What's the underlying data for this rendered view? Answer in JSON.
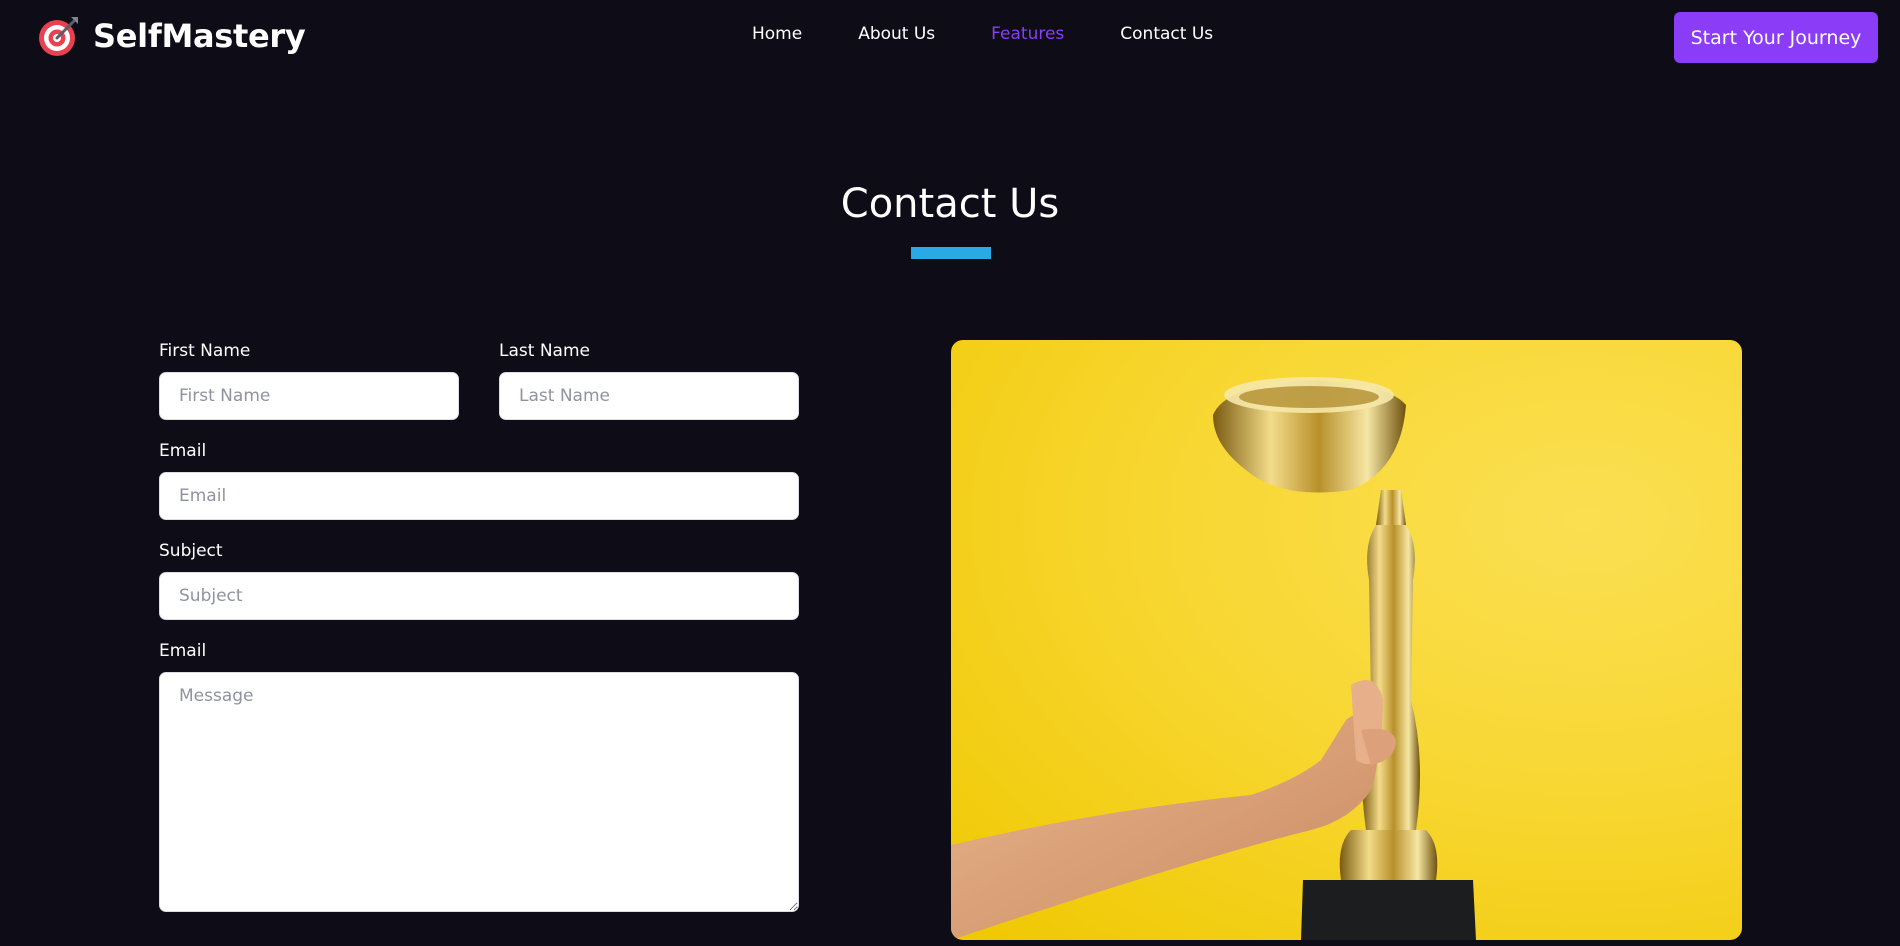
{
  "brand": {
    "name": "SelfMastery",
    "icon": "target-dart-icon"
  },
  "nav": {
    "items": [
      {
        "label": "Home",
        "active": false
      },
      {
        "label": "About Us",
        "active": false
      },
      {
        "label": "Features",
        "active": true
      },
      {
        "label": "Contact Us",
        "active": false
      }
    ],
    "cta_label": "Start Your Journey"
  },
  "contact": {
    "title": "Contact Us",
    "fields": {
      "first_name": {
        "label": "First Name",
        "placeholder": "First Name",
        "value": ""
      },
      "last_name": {
        "label": "Last Name",
        "placeholder": "Last Name",
        "value": ""
      },
      "email": {
        "label": "Email",
        "placeholder": "Email",
        "value": ""
      },
      "subject": {
        "label": "Subject",
        "placeholder": "Subject",
        "value": ""
      },
      "message": {
        "label": "Email",
        "placeholder": "Message",
        "value": ""
      }
    }
  },
  "colors": {
    "background": "#0e0d17",
    "accent": "#8b3cf7",
    "underline": "#29a9e6",
    "image_background": "#f8d733"
  }
}
